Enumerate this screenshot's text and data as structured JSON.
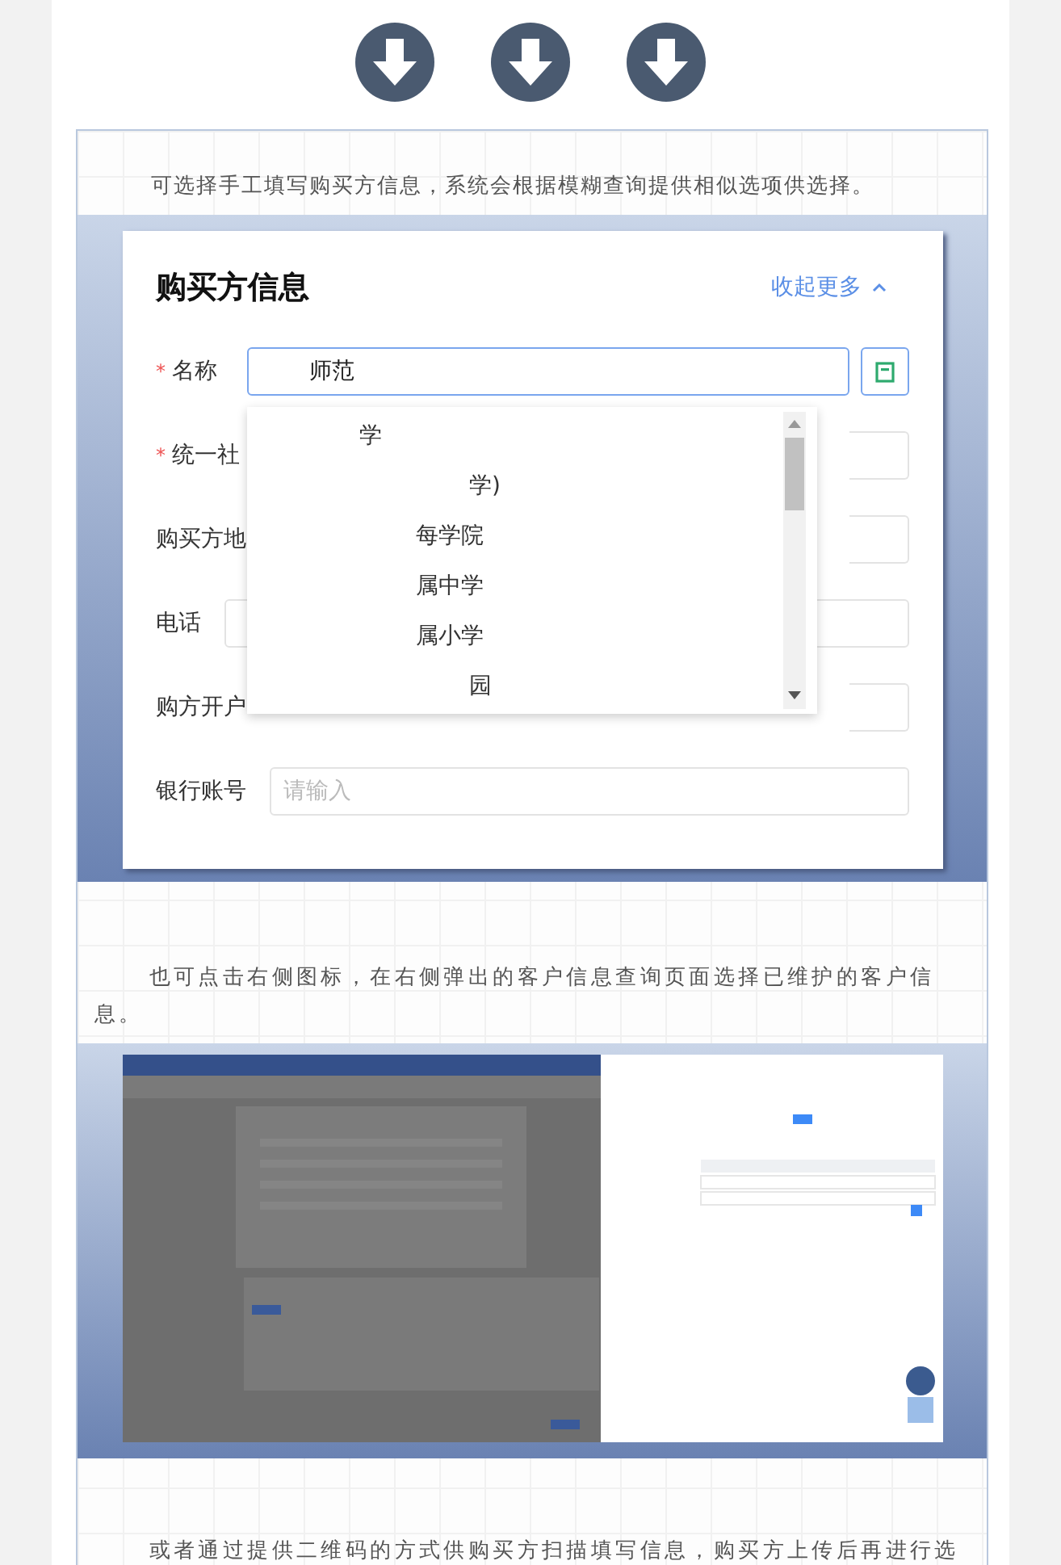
{
  "intro": "可选择手工填写购买方信息，系统会根据模糊查询提供相似选项供选择。",
  "form": {
    "title": "购买方信息",
    "toggle": "收起更多",
    "fields": [
      {
        "required_mark": "*",
        "label": "名称",
        "value": "师范",
        "kind": "name"
      },
      {
        "required_mark": "*",
        "label": "统一社",
        "kind": "covered"
      },
      {
        "label": "购买方地",
        "kind": "covered"
      },
      {
        "label": "电话",
        "kind": "phone"
      },
      {
        "label": "购方开户",
        "kind": "covered"
      },
      {
        "label": "银行账号",
        "placeholder": "请输入",
        "kind": "plain"
      }
    ],
    "dropdown": {
      "options": [
        {
          "text": "学"
        },
        {
          "text": "学)"
        },
        {
          "text": "每学院"
        },
        {
          "text": "属中学"
        },
        {
          "text": "属小学"
        },
        {
          "text": "园"
        }
      ]
    }
  },
  "paragraph_2": "也可点击右侧图标，在右侧弹出的客户信息查询页面选择已维护的客户信息。",
  "paragraph_3": "或者通过提供二维码的方式供购买方扫描填写信息，购买方上传后再进行选"
}
